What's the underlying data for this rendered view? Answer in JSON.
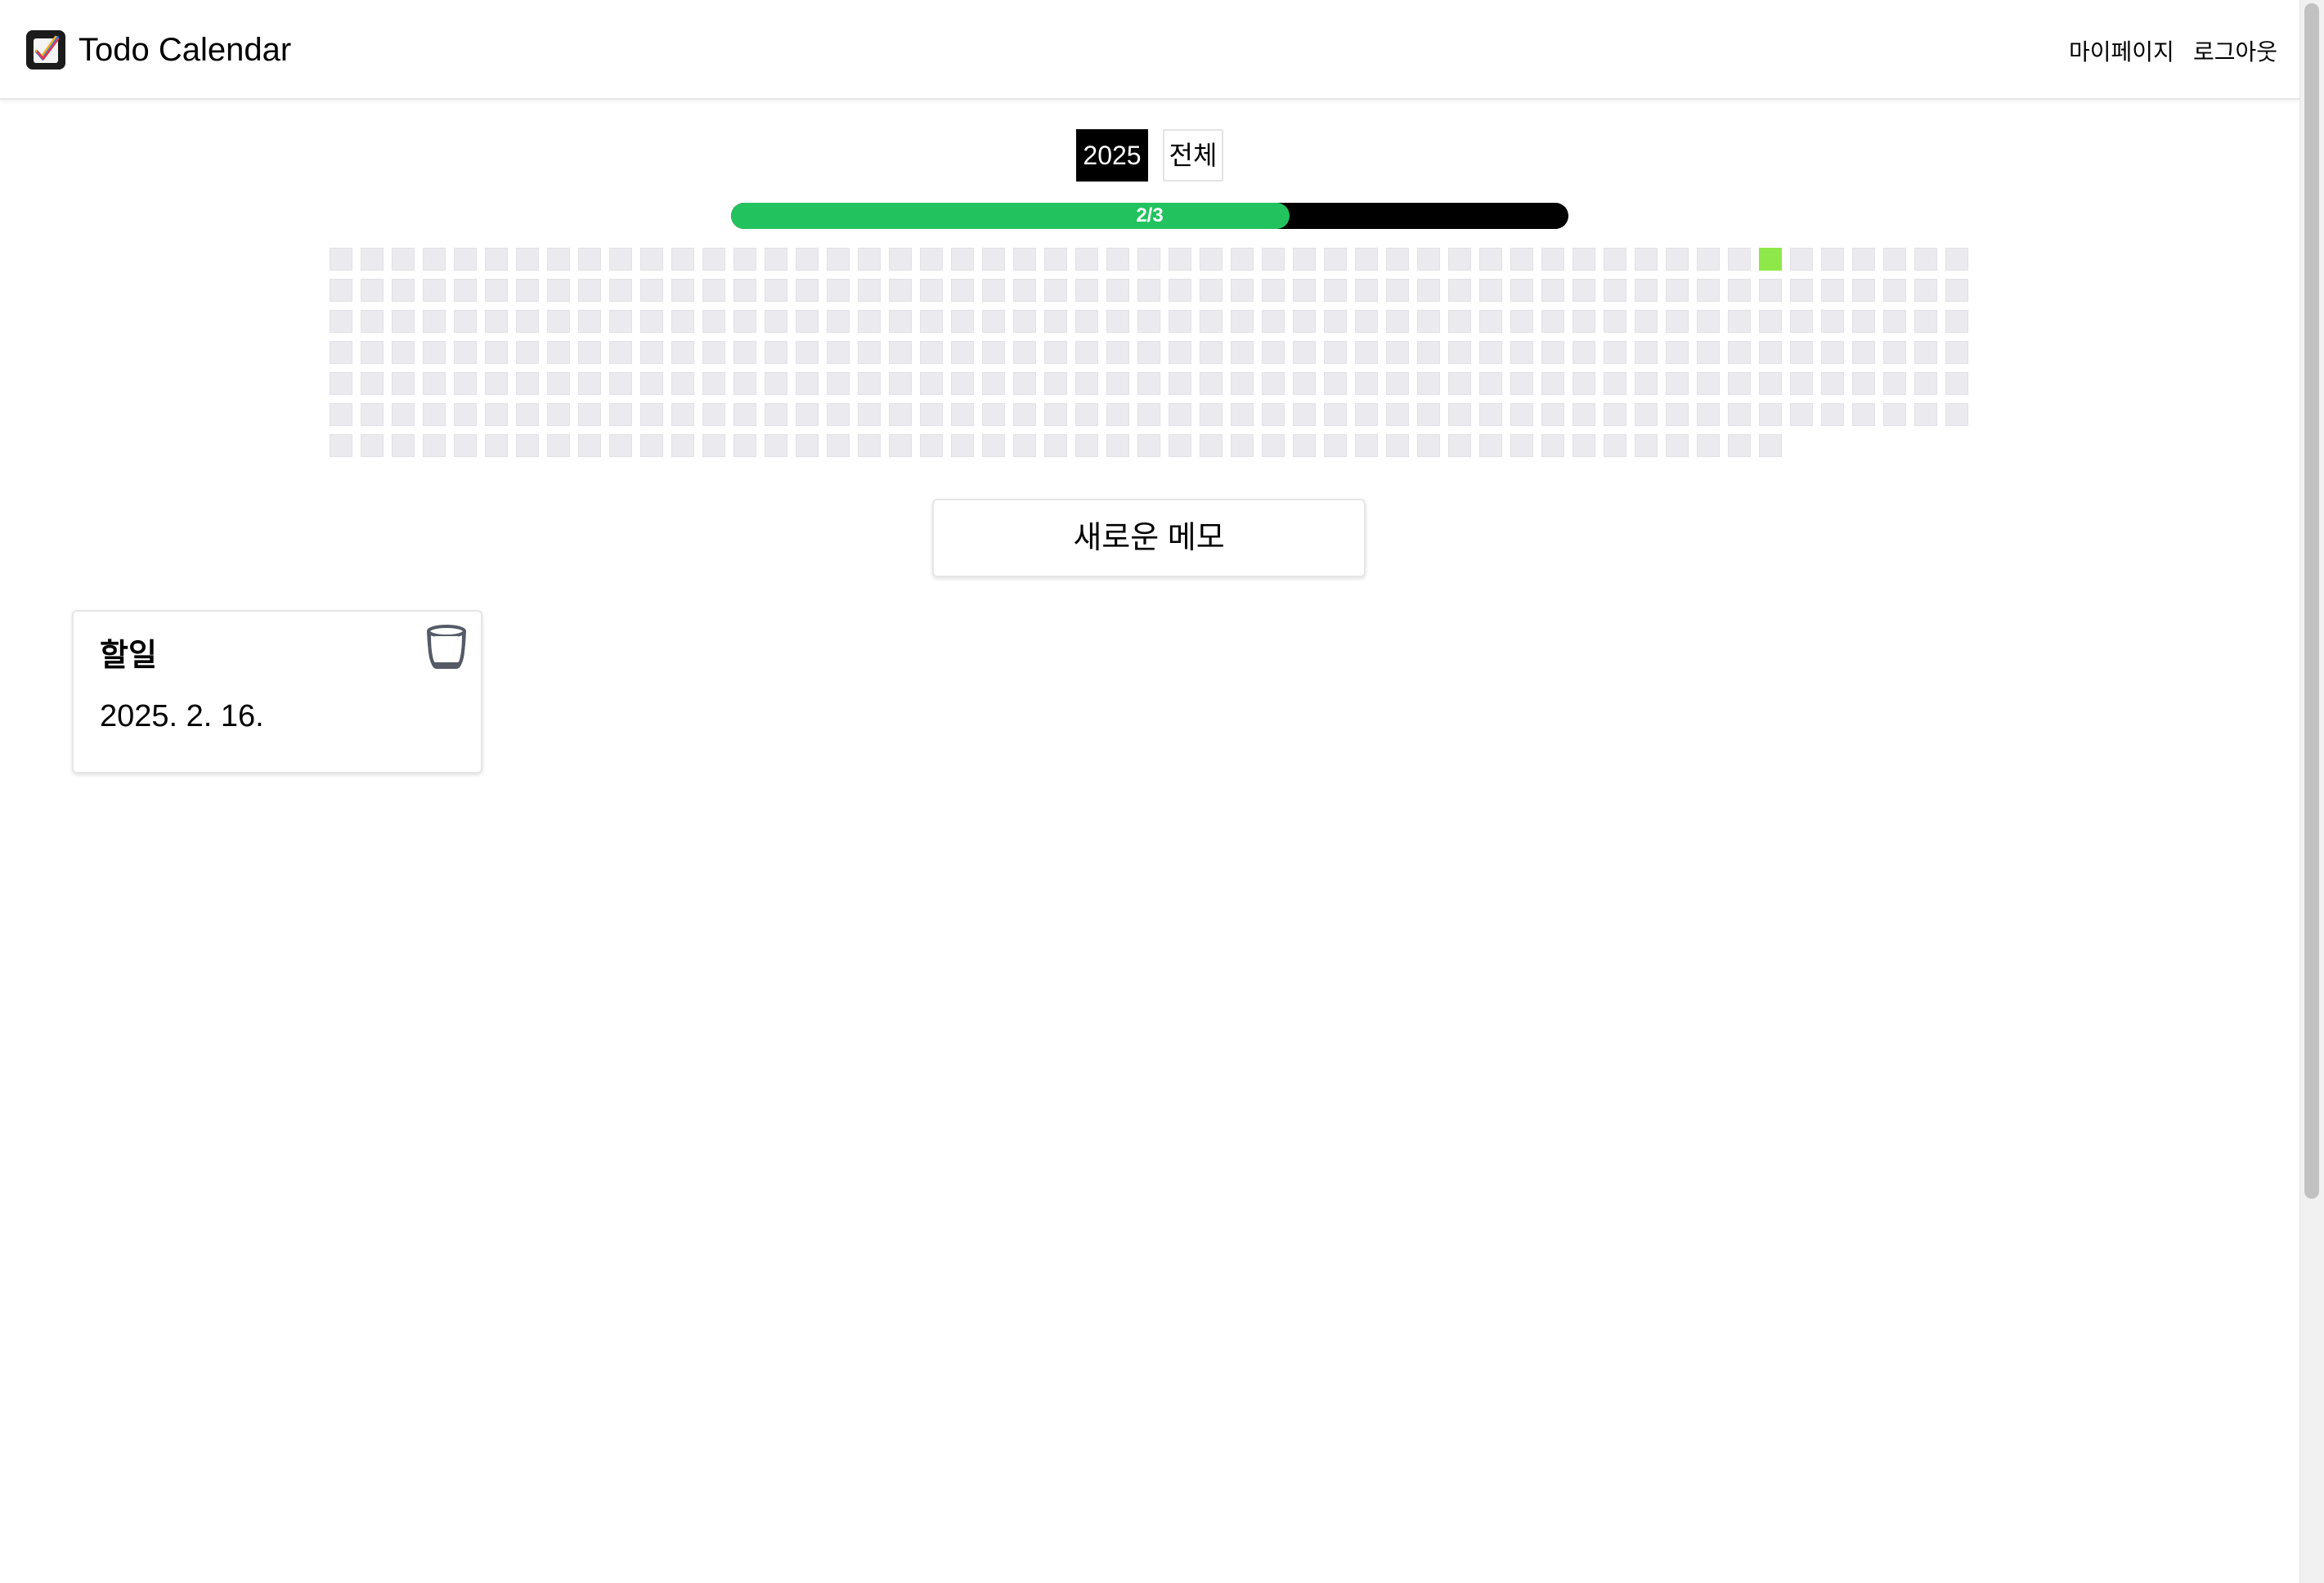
{
  "header": {
    "title": "Todo Calendar",
    "logo_icon": "checkmark-logo-icon",
    "nav": {
      "mypage": "마이페이지",
      "logout": "로그아웃"
    }
  },
  "year_filter": {
    "active": "2025",
    "all": "전체"
  },
  "progress": {
    "label": "2/3",
    "fraction": 0.667,
    "fill_color": "#22c35e",
    "track_color": "#000000"
  },
  "calendar_grid": {
    "cell_color": "#ebebef",
    "done_color": "#8fe84a"
  },
  "new_memo_button": "새로운 메모",
  "todos": [
    {
      "title": "할일",
      "date": "2025. 2. 16.",
      "delete_icon": "trash-icon"
    }
  ]
}
